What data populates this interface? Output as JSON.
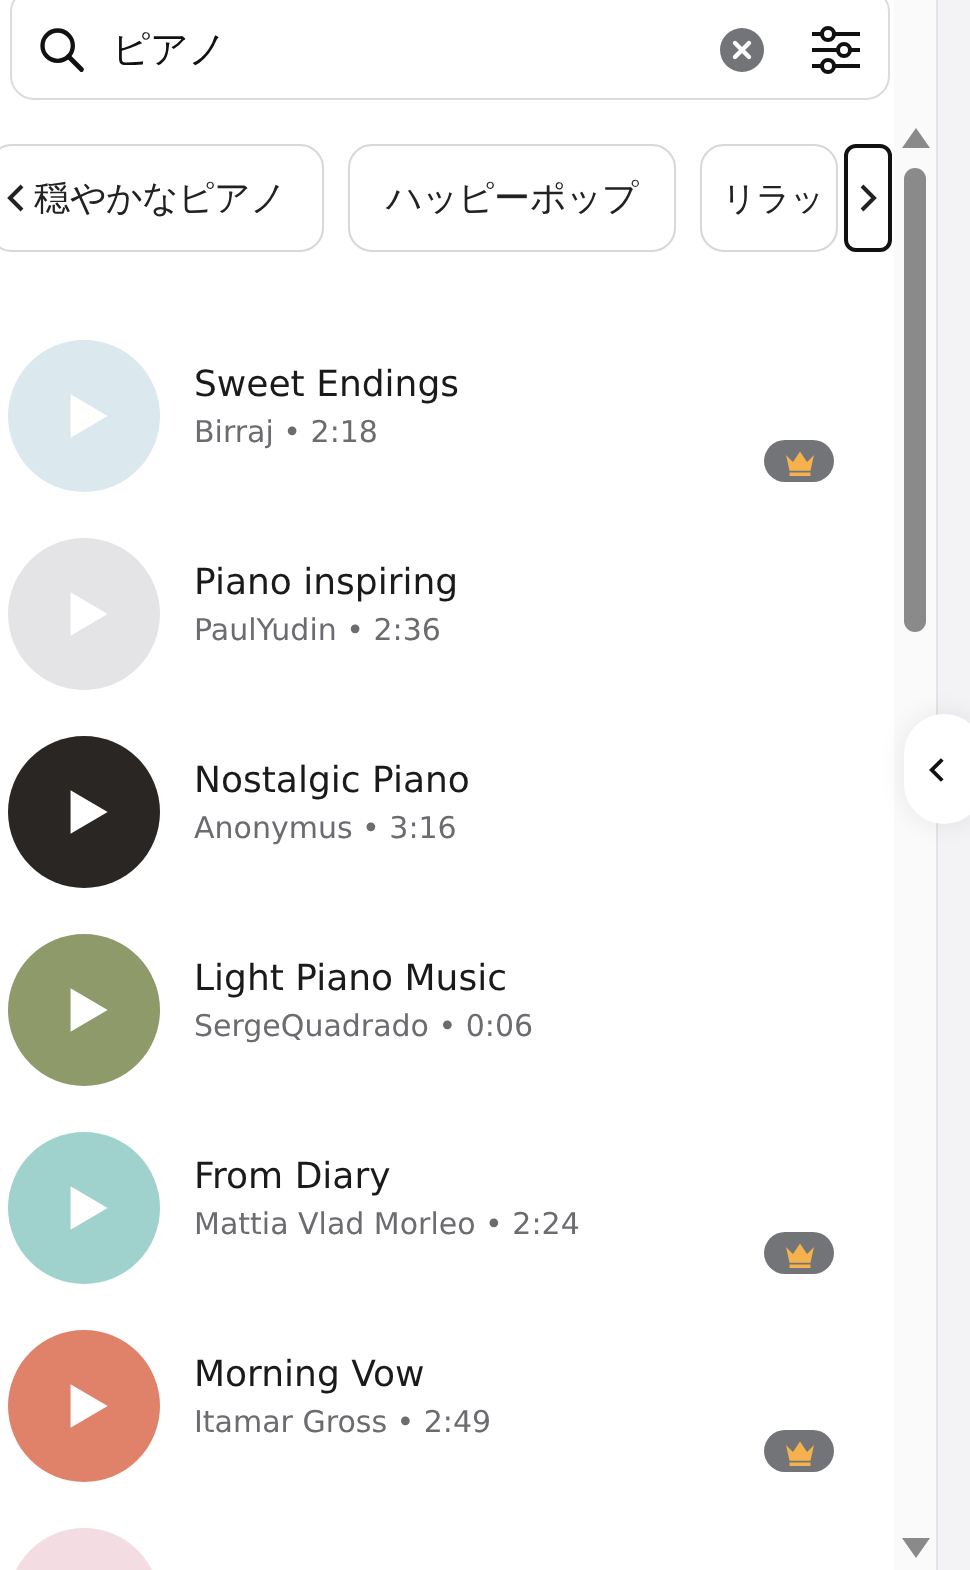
{
  "search": {
    "value": "ピアノ"
  },
  "chips": [
    {
      "label": "穏やかなピアノ"
    },
    {
      "label": "ハッピーポップ"
    },
    {
      "label": "リラッ"
    }
  ],
  "tracks": [
    {
      "title": "Sweet Endings",
      "subtitle": "Birraj • 2:18",
      "premium": true,
      "color": "#dbe8ee"
    },
    {
      "title": "Piano inspiring",
      "subtitle": "PaulYudin • 2:36",
      "premium": false,
      "color": "#e4e4e6"
    },
    {
      "title": "Nostalgic Piano",
      "subtitle": "Anonymus • 3:16",
      "premium": false,
      "color": "#2a2624"
    },
    {
      "title": "Light Piano Music",
      "subtitle": "SergeQuadrado • 0:06",
      "premium": false,
      "color": "#8e9a6a"
    },
    {
      "title": "From Diary",
      "subtitle": "Mattia Vlad Morleo • 2:24",
      "premium": true,
      "color": "#9fd2cc"
    },
    {
      "title": "Morning Vow",
      "subtitle": "Itamar Gross • 2:49",
      "premium": true,
      "color": "#e0826a"
    }
  ]
}
